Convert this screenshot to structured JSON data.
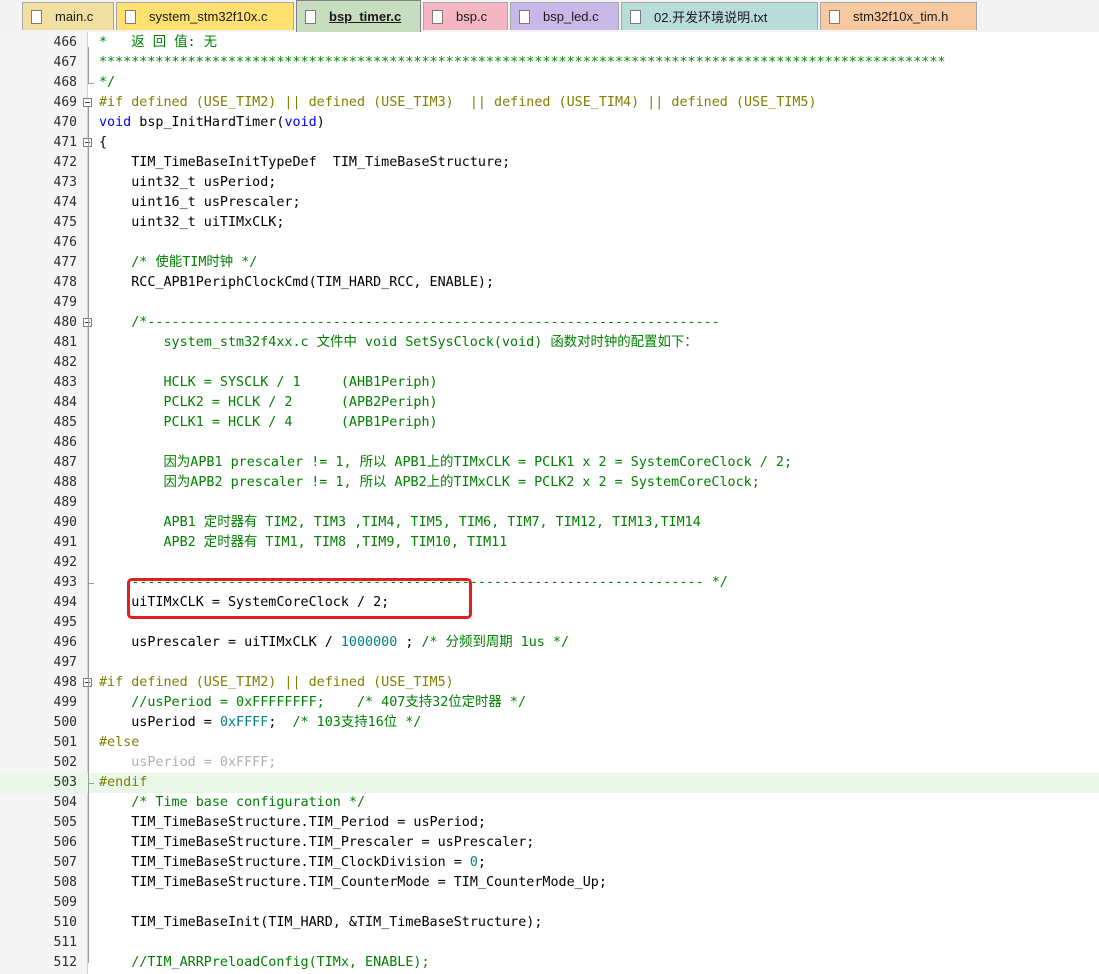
{
  "tabs": [
    {
      "label": "main.c",
      "color": "#f0dfa0",
      "active": false
    },
    {
      "label": "system_stm32f10x.c",
      "color": "#ffe070",
      "active": false
    },
    {
      "label": "bsp_timer.c",
      "color": "#c8dcc0",
      "active": true
    },
    {
      "label": "bsp.c",
      "color": "#f4b6c2",
      "active": false
    },
    {
      "label": "bsp_led.c",
      "color": "#c8b8e8",
      "active": false
    },
    {
      "label": "02.开发环境说明.txt",
      "color": "#b8dcd8",
      "active": false
    },
    {
      "label": "stm32f10x_tim.h",
      "color": "#f8c8a0",
      "active": false
    }
  ],
  "lines": [
    {
      "n": "466",
      "t": "*   返 回 值: 无",
      "c": "comment"
    },
    {
      "n": "467",
      "t": "*********************************************************************************************************",
      "c": "comment"
    },
    {
      "n": "468",
      "t": "*/",
      "c": "comment"
    },
    {
      "n": "469",
      "t": "#if defined (USE_TIM2) || defined (USE_TIM3)  || defined (USE_TIM4) || defined (USE_TIM5)",
      "c": "pre"
    },
    {
      "n": "470",
      "t": "void bsp_InitHardTimer(void)",
      "c": "kwfunc"
    },
    {
      "n": "471",
      "t": "{",
      "c": "plain"
    },
    {
      "n": "472",
      "t": "    TIM_TimeBaseInitTypeDef  TIM_TimeBaseStructure;",
      "c": "plain"
    },
    {
      "n": "473",
      "t": "    uint32_t usPeriod;",
      "c": "plain"
    },
    {
      "n": "474",
      "t": "    uint16_t usPrescaler;",
      "c": "plain"
    },
    {
      "n": "475",
      "t": "    uint32_t uiTIMxCLK;",
      "c": "plain"
    },
    {
      "n": "476",
      "t": "",
      "c": "plain"
    },
    {
      "n": "477",
      "t": "    /* 使能TIM时钟 */",
      "c": "comment"
    },
    {
      "n": "478",
      "t": "    RCC_APB1PeriphClockCmd(TIM_HARD_RCC, ENABLE);",
      "c": "plain"
    },
    {
      "n": "479",
      "t": "",
      "c": "plain"
    },
    {
      "n": "480",
      "t": "    /*-----------------------------------------------------------------------",
      "c": "comment"
    },
    {
      "n": "481",
      "t": "        system_stm32f4xx.c 文件中 void SetSysClock(void) 函数对时钟的配置如下：",
      "c": "comment"
    },
    {
      "n": "482",
      "t": "",
      "c": "comment"
    },
    {
      "n": "483",
      "t": "        HCLK = SYSCLK / 1     (AHB1Periph)",
      "c": "comment"
    },
    {
      "n": "484",
      "t": "        PCLK2 = HCLK / 2      (APB2Periph)",
      "c": "comment"
    },
    {
      "n": "485",
      "t": "        PCLK1 = HCLK / 4      (APB1Periph)",
      "c": "comment"
    },
    {
      "n": "486",
      "t": "",
      "c": "comment"
    },
    {
      "n": "487",
      "t": "        因为APB1 prescaler != 1, 所以 APB1上的TIMxCLK = PCLK1 x 2 = SystemCoreClock / 2;",
      "c": "comment"
    },
    {
      "n": "488",
      "t": "        因为APB2 prescaler != 1, 所以 APB2上的TIMxCLK = PCLK2 x 2 = SystemCoreClock;",
      "c": "comment"
    },
    {
      "n": "489",
      "t": "",
      "c": "comment"
    },
    {
      "n": "490",
      "t": "        APB1 定时器有 TIM2, TIM3 ,TIM4, TIM5, TIM6, TIM7, TIM12, TIM13,TIM14",
      "c": "comment"
    },
    {
      "n": "491",
      "t": "        APB2 定时器有 TIM1, TIM8 ,TIM9, TIM10, TIM11",
      "c": "comment"
    },
    {
      "n": "492",
      "t": "",
      "c": "comment"
    },
    {
      "n": "493",
      "t": "    ----------------------------------------------------------------------- */",
      "c": "comment"
    },
    {
      "n": "494",
      "t": "    uiTIMxCLK = SystemCoreClock / 2;",
      "c": "plain"
    },
    {
      "n": "495",
      "t": "",
      "c": "plain"
    },
    {
      "n": "496",
      "t": "    usPrescaler = uiTIMxCLK / 1000000 ; /* 分频到周期 1us */",
      "c": "prescaler"
    },
    {
      "n": "497",
      "t": "",
      "c": "plain"
    },
    {
      "n": "498",
      "t": "#if defined (USE_TIM2) || defined (USE_TIM5)",
      "c": "pre"
    },
    {
      "n": "499",
      "t": "    //usPeriod = 0xFFFFFFFF;    /* 407支持32位定时器 */",
      "c": "comment"
    },
    {
      "n": "500",
      "t": "    usPeriod = 0xFFFF;  /* 103支持16位 */",
      "c": "period"
    },
    {
      "n": "501",
      "t": "#else",
      "c": "pre"
    },
    {
      "n": "502",
      "t": "    usPeriod = 0xFFFF;",
      "c": "inactive"
    },
    {
      "n": "503",
      "t": "#endif",
      "c": "pre"
    },
    {
      "n": "504",
      "t": "    /* Time base configuration */",
      "c": "comment"
    },
    {
      "n": "505",
      "t": "    TIM_TimeBaseStructure.TIM_Period = usPeriod;",
      "c": "plain"
    },
    {
      "n": "506",
      "t": "    TIM_TimeBaseStructure.TIM_Prescaler = usPrescaler;",
      "c": "plain"
    },
    {
      "n": "507",
      "t": "    TIM_TimeBaseStructure.TIM_ClockDivision = 0;",
      "c": "clockdiv"
    },
    {
      "n": "508",
      "t": "    TIM_TimeBaseStructure.TIM_CounterMode = TIM_CounterMode_Up;",
      "c": "plain"
    },
    {
      "n": "509",
      "t": "",
      "c": "plain"
    },
    {
      "n": "510",
      "t": "    TIM_TimeBaseInit(TIM_HARD, &TIM_TimeBaseStructure);",
      "c": "plain"
    },
    {
      "n": "511",
      "t": "",
      "c": "plain"
    },
    {
      "n": "512",
      "t": "    //TIM_ARRPreloadConfig(TIMx, ENABLE);",
      "c": "comment"
    }
  ],
  "colors": {
    "comment": "#008000",
    "keyword": "#0000ff",
    "preprocessor": "#808000",
    "number": "#008080",
    "inactive": "#b0b0b0",
    "current_line": "#e8f7e8",
    "annotation_box": "#e02020"
  }
}
